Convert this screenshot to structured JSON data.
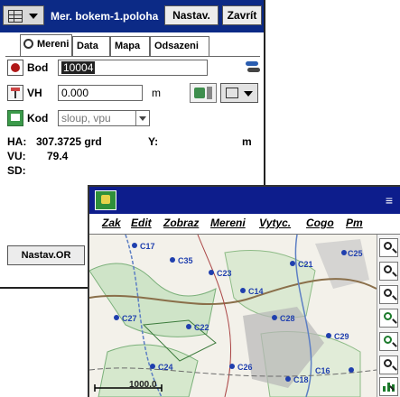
{
  "win1": {
    "title": "Mer. bokem-1.poloha",
    "nastav_label": "Nastav.",
    "zavrit_label": "Zavrít",
    "tabs": [
      "Mereni",
      "Data",
      "Mapa",
      "Odsazeni"
    ],
    "bod": {
      "label": "Bod",
      "value": "10004"
    },
    "vh": {
      "label": "VH",
      "value": "0.000",
      "unit": "m"
    },
    "kod": {
      "label": "Kod",
      "value": "sloup, vpu"
    },
    "ha": {
      "label": "HA:",
      "value": "307.3725 grd",
      "y_label": "Y:",
      "unit": "m"
    },
    "vu": {
      "label": "VU:",
      "value": "79.4"
    },
    "sd": {
      "label": "SD:"
    },
    "bottom_button": "Nastav.OR"
  },
  "win2": {
    "title": "",
    "close": "≡",
    "menu": [
      "Zak",
      "Edit",
      "Zobraz",
      "Mereni",
      "Vytyc.",
      "Cogo",
      "Pm"
    ],
    "scale_label": "1000.0",
    "map_labels": [
      "C17",
      "C35",
      "C23",
      "C14",
      "C21",
      "C25",
      "C27",
      "C22",
      "C28",
      "C29",
      "C24",
      "C26",
      "C18",
      "C16"
    ]
  },
  "colors": {
    "title_blue": "#0c2a86",
    "map_blue": "#1f3fae",
    "map_green": "#3b9a4a"
  }
}
